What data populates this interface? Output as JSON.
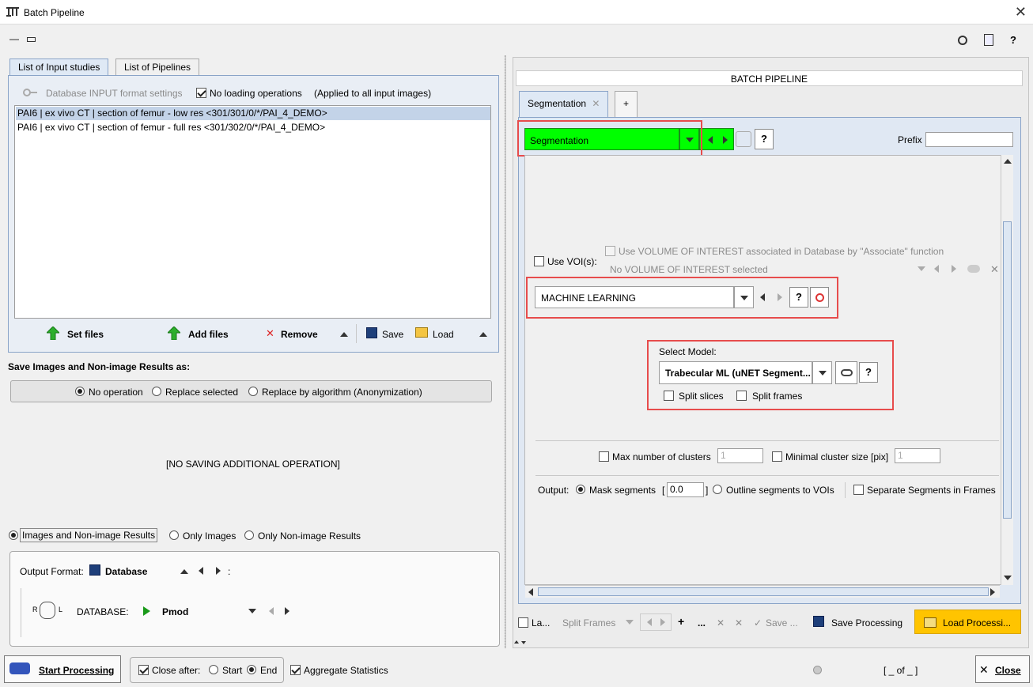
{
  "window": {
    "title": "Batch Pipeline"
  },
  "left_tabs": [
    "List of Input studies",
    "List of Pipelines"
  ],
  "input": {
    "db_format_label": "Database INPUT format settings",
    "no_loading_label": "No loading operations",
    "applied_note": "(Applied to all input images)",
    "rows": [
      "PAI6 | ex vivo CT | section of femur - low res <301/301/0/*/PAI_4_DEMO>",
      "PAI6 | ex vivo CT | section of femur - full res <301/302/0/*/PAI_4_DEMO>"
    ],
    "set_files": "Set files",
    "add_files": "Add files",
    "remove": "Remove",
    "save": "Save",
    "load": "Load"
  },
  "save_section": {
    "title": "Save Images and Non-image Results  as:",
    "opt_no_op": "No operation",
    "opt_replace": "Replace selected",
    "opt_replace_alg": "Replace by algorithm (Anonymization)",
    "no_saving": "[NO SAVING ADDITIONAL OPERATION]"
  },
  "output_section": {
    "opt_images_results": "Images and Non-image Results",
    "opt_only_images": "Only Images",
    "opt_only_nonimage": "Only Non-image Results",
    "output_format_label": "Output Format:",
    "output_format_value": "Database",
    "colon": ":",
    "database_label": "DATABASE:",
    "database_value": "Pmod",
    "rl_r": "R",
    "rl_l": "L"
  },
  "bottom": {
    "start_processing": "Start Processing",
    "close_after": "Close after:",
    "start": "Start",
    "end": "End",
    "aggregate": "Aggregate Statistics",
    "page_indicator": "[ _ of _ ]",
    "close": "Close"
  },
  "pipeline": {
    "header": "BATCH PIPELINE",
    "tab_label": "Segmentation",
    "plus": "+",
    "combo_value": "Segmentation",
    "help": "?",
    "prefix_label": "Prefix",
    "use_vois": "Use VOI(s):",
    "use_voi_assoc": "Use VOLUME OF INTEREST associated in Database by \"Associate\" function",
    "no_voi": "No VOLUME OF INTEREST selected",
    "method_value": "MACHINE LEARNING",
    "select_model": "Select Model:",
    "model_value": "Trabecular ML (uNET Segment...",
    "split_slices": "Split slices",
    "split_frames": "Split frames",
    "max_clusters": "Max number of clusters",
    "max_clusters_val": "1",
    "min_cluster": "Minimal cluster size [pix]",
    "min_cluster_val": "1",
    "output_label": "Output:",
    "mask_segments": "Mask segments",
    "bracket_open": "[",
    "mask_val": "0.0",
    "bracket_close": "]",
    "outline_segments": "Outline segments to VOIs",
    "separate_segments": "Separate Segments in Frames",
    "la": "La...",
    "split_frames_bottom": "Split Frames",
    "plus_bottom": "+",
    "dots": "...",
    "save_bottom": "Save ...",
    "save_processing": "Save Processing",
    "load_processing": "Load Processi..."
  },
  "colors": {
    "green_combo": "#00ff00",
    "red_highlight": "#e74c4c",
    "yellow_button": "#ffc400",
    "list_selected": "#c3d3e8"
  }
}
